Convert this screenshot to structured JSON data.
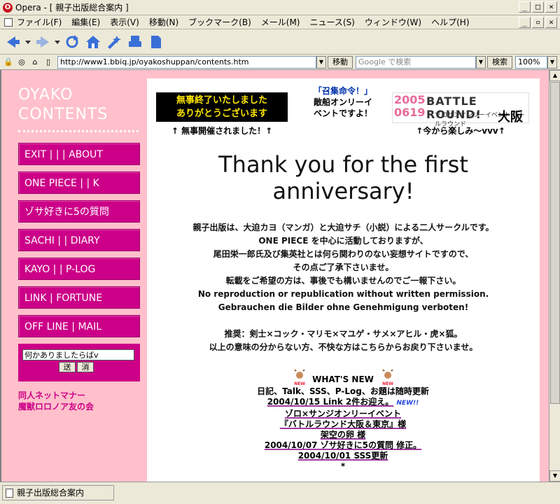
{
  "window": {
    "title": "Opera - [ 親子出版総合案内 ]"
  },
  "menu": [
    "ファイル(F)",
    "編集(E)",
    "表示(V)",
    "移動(N)",
    "ブックマーク(B)",
    "メール(M)",
    "ニュース(S)",
    "ウィンドウ(W)",
    "ヘルプ(H)"
  ],
  "address": {
    "url": "http://www1.bbiq.jp/oyakoshuppan/contents.htm",
    "go_label": "移動",
    "search_placeholder": "Google で検索",
    "search_label": "検索",
    "zoom": "100%"
  },
  "status": {
    "text": "親子出版総合案内"
  },
  "sidebar": {
    "logo_line1": "OYAKO",
    "logo_line2": "CONTENTS",
    "nav": [
      "EXIT | | | ABOUT",
      "ONE PIECE | | K",
      "ゾサ好きに5の質問",
      "SACHI | | DIARY",
      "KAYO | | P-LOG",
      "LINK | FORTUNE",
      "OFF LINE | MAIL"
    ],
    "form_value": "何かありましたらばv",
    "send_label": "送",
    "clear_label": "消",
    "footer_line1": "同人ネットマナー",
    "footer_line2": "魔獣ロロノア友の会"
  },
  "banners": {
    "left_line1": "無事終了いたしました",
    "left_line2": "ありがとうございます",
    "left_caption": "↑ 無事開催されました！↑",
    "summon_title": "「召集命令！」",
    "summon_text": "敵船オンリーイベントですよ！",
    "right_year_top": "2005",
    "right_year_bottom": "0619",
    "right_title": "BATTLE ROUND!",
    "right_sub": "ゾロサンオンリーイベント バトルラウンド",
    "right_city": "大阪",
    "right_caption": "↑今から楽しみ～vvv↑"
  },
  "headline": "Thank you for the first anniversary!",
  "intro": [
    "親子出版は、大迫カヨ（マンガ）と大迫サチ（小説）による二人サークルです。",
    "ONE PIECE を中心に活動しておりますが、",
    "尾田栄一郎氏及び集英社とは何ら関わりのない妄想サイトですので、",
    "その点ご了承下さいませ。",
    "転載をご希望の方は、事後でも構いませんのでご一報下さい。",
    "No reproduction or republication without written permission.",
    "Gebrauchen die Bilder ohne Genehmigung verboten!",
    "",
    "推奨：剣士×コック・マリモ×マユゲ・サメ×アヒル・虎×狐。",
    "以上の意味の分からない方、不快な方はこちらからお戻り下さいませ。"
  ],
  "news": {
    "title": "WHAT'S NEW",
    "badge": "NEW",
    "new_badge": "NEW!!",
    "items": [
      "日記、Talk、SSS、P-Log、お題は随時更新",
      "2004/10/15 Link 2件お迎え。",
      "ゾロ×サンジオンリーイベント",
      "『バトルラウンド大阪＆東京』様",
      "架空の卵 様",
      "2004/10/07 ゾサ好きに5の質問 修正。",
      "2004/10/01 SSS更新",
      "*"
    ]
  },
  "colors": {
    "page_bg": "#ffc0cb",
    "nav_bg": "#cc0088",
    "content_bg": "#ffffff"
  }
}
